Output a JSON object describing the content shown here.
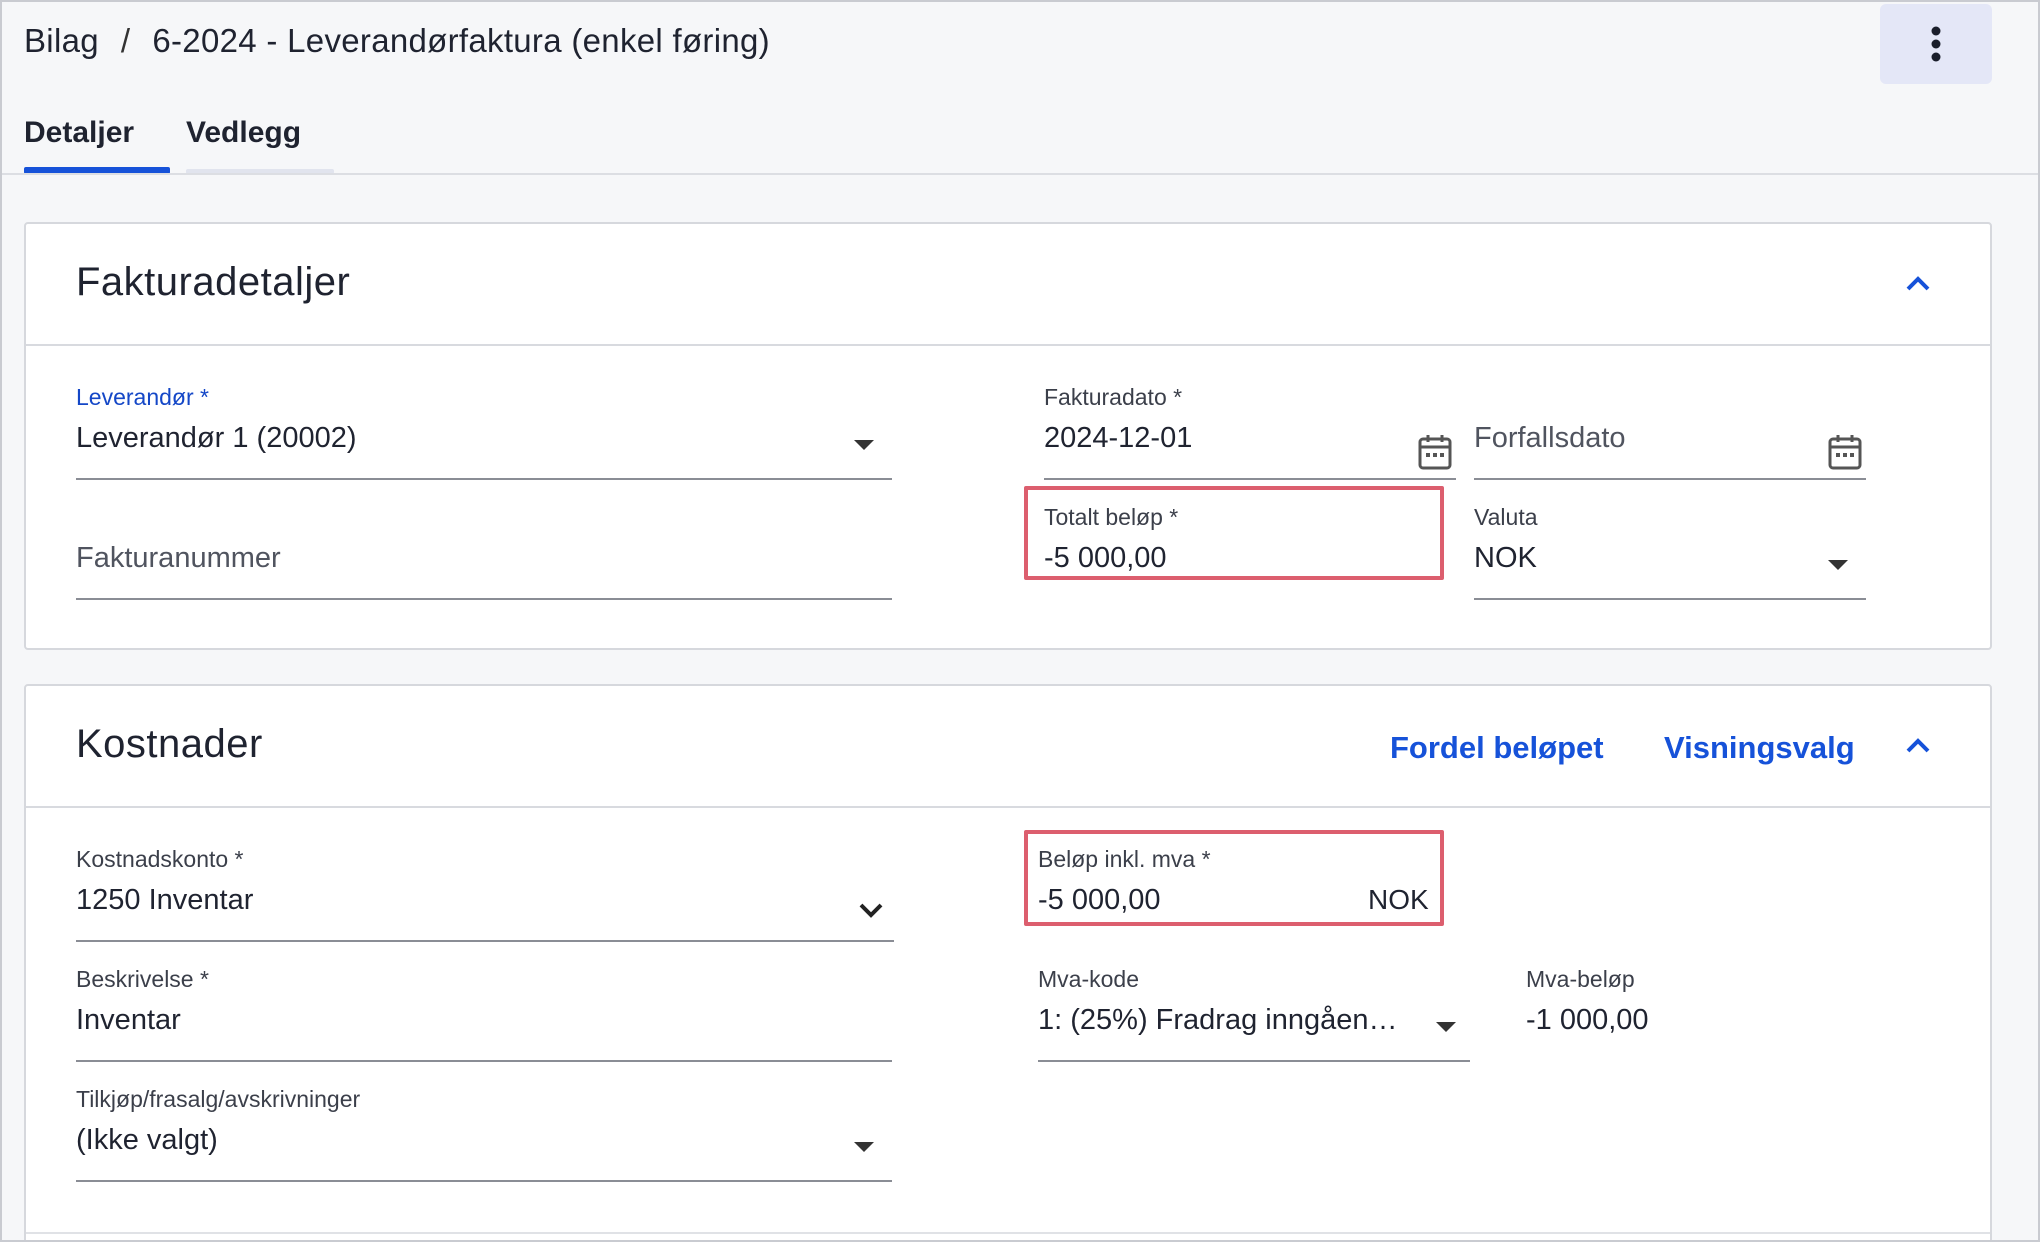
{
  "breadcrumb": {
    "root": "Bilag",
    "separator": "/",
    "current": "6-2024 - Leverandørfaktura (enkel føring)"
  },
  "tabs": [
    {
      "label": "Detaljer",
      "active": true
    },
    {
      "label": "Vedlegg",
      "active": false
    }
  ],
  "invoice_details": {
    "title": "Fakturadetaljer",
    "supplier": {
      "label": "Leverandør *",
      "value": "Leverandør 1 (20002)"
    },
    "invoice_number": {
      "placeholder": "Fakturanummer"
    },
    "invoice_date": {
      "label": "Fakturadato *",
      "value": "2024-12-01"
    },
    "due_date": {
      "placeholder": "Forfallsdato"
    },
    "total_amount": {
      "label": "Totalt beløp *",
      "value": "-5 000,00"
    },
    "currency": {
      "label": "Valuta",
      "value": "NOK"
    }
  },
  "costs": {
    "title": "Kostnader",
    "distribute_link": "Fordel beløpet",
    "view_options_link": "Visningsvalg",
    "cost_account": {
      "label": "Kostnadskonto *",
      "value": "1250 Inventar"
    },
    "amount_incl_vat": {
      "label": "Beløp inkl. mva *",
      "value": "-5 000,00",
      "unit": "NOK"
    },
    "description": {
      "label": "Beskrivelse *",
      "value": "Inventar"
    },
    "vat_code": {
      "label": "Mva-kode",
      "value": "1: (25%) Fradrag inngåen…"
    },
    "vat_amount": {
      "label": "Mva-beløp",
      "value": "-1 000,00"
    },
    "acquisition": {
      "label": "Tilkjøp/frasalg/avskrivninger",
      "value": "(Ikke valgt)"
    }
  },
  "colors": {
    "accent": "#1652d9",
    "highlight": "#dc5e6e",
    "kebab_bg": "#e4e7f7"
  },
  "icons": {
    "more": "kebab-vertical-icon",
    "collapse": "chevron-up-icon",
    "calendar": "calendar-icon",
    "dropdown": "caret-down-icon",
    "select": "chevron-down-icon"
  }
}
